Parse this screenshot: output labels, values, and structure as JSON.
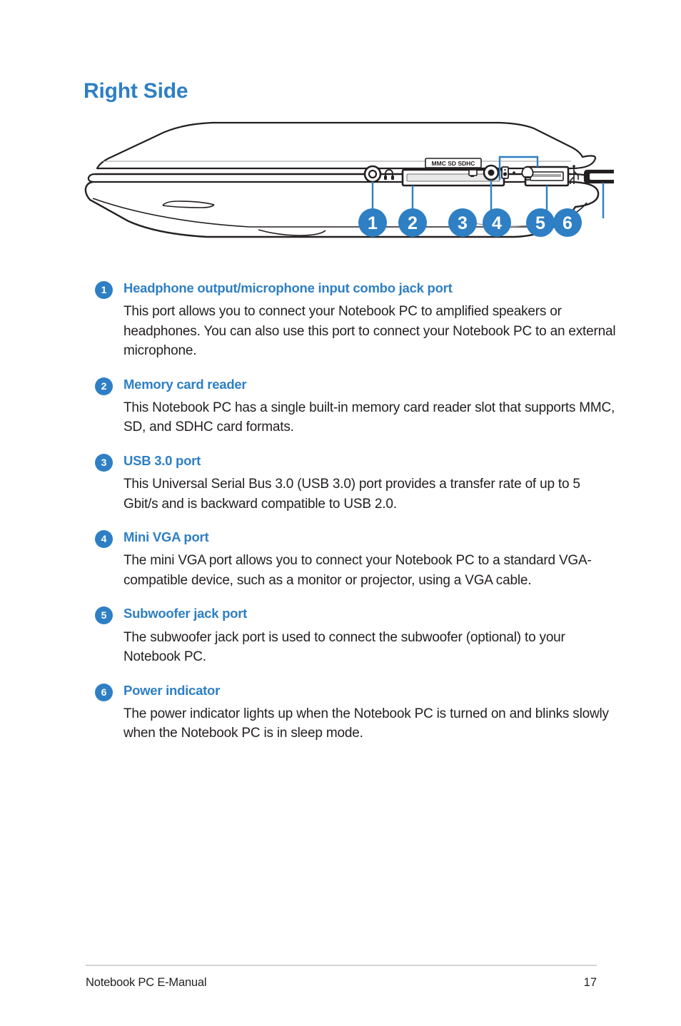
{
  "page": {
    "title": "Right Side",
    "accent_color": "#2e7fc4",
    "text_color": "#231f20"
  },
  "diagram": {
    "name": "notebook-pc-right-side-illustration",
    "card_slot_label": "MMC SD SDHC",
    "callouts": [
      {
        "number": "1",
        "target": "headphone-combo-jack"
      },
      {
        "number": "2",
        "target": "memory-card-reader"
      },
      {
        "number": "3",
        "target": "usb-3-port"
      },
      {
        "number": "4",
        "target": "mini-vga-port"
      },
      {
        "number": "5",
        "target": "subwoofer-jack"
      },
      {
        "number": "6",
        "target": "power-indicator"
      }
    ]
  },
  "items": [
    {
      "number": "1",
      "title": "Headphone output/microphone input combo jack port",
      "body": "This port allows you to connect your Notebook PC to amplified speakers or headphones. You can also use this port to connect your Notebook PC to an external microphone."
    },
    {
      "number": "2",
      "title": "Memory card reader",
      "body": "This Notebook PC has a single built-in memory card reader slot that supports MMC, SD, and SDHC card formats."
    },
    {
      "number": "3",
      "title": "USB 3.0 port",
      "body": "This Universal Serial Bus 3.0 (USB 3.0) port provides a transfer rate of up to 5 Gbit/s and is backward compatible to USB 2.0."
    },
    {
      "number": "4",
      "title": "Mini VGA port",
      "body": "The mini VGA port allows you to connect your Notebook PC to a standard VGA-compatible device, such as a monitor or projector, using a VGA cable."
    },
    {
      "number": "5",
      "title": "Subwoofer jack port",
      "body": "The subwoofer jack port is used to connect the subwoofer (optional) to your Notebook PC."
    },
    {
      "number": "6",
      "title": "Power indicator",
      "body": "The power indicator lights up when the Notebook PC is turned on and blinks slowly when the Notebook PC is in sleep mode."
    }
  ],
  "footer": {
    "document_name": "Notebook PC E-Manual",
    "page_number": "17"
  }
}
